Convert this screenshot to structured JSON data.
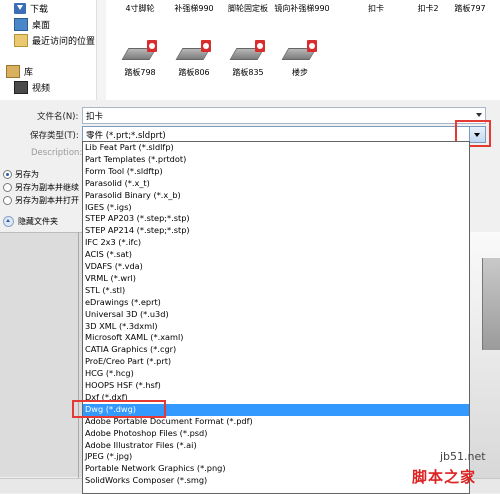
{
  "nav": {
    "items": [
      {
        "label": "下载",
        "icon": "download-folder-icon"
      },
      {
        "label": "桌面",
        "icon": "desktop-icon"
      },
      {
        "label": "最近访问的位置",
        "icon": "recent-places-icon"
      },
      {
        "label": "库",
        "icon": "library-icon"
      },
      {
        "label": "视频",
        "icon": "video-icon"
      }
    ]
  },
  "files": [
    {
      "label": "4寸脚轮"
    },
    {
      "label": "补强梯990"
    },
    {
      "label": "脚轮固定板"
    },
    {
      "label": "镜向补强梯990"
    },
    {
      "label": "扣卡"
    },
    {
      "label": "扣卡2"
    },
    {
      "label": "踏板797"
    },
    {
      "label": "踏板798"
    },
    {
      "label": "踏板806"
    },
    {
      "label": "踏板835"
    },
    {
      "label": "楼步"
    }
  ],
  "form": {
    "filename_label": "文件名(N):",
    "filename_value": "扣卡",
    "savetype_label": "保存类型(T):",
    "savetype_value": "零件 (*.prt;*.sldprt)",
    "description_label": "Description:",
    "options": [
      {
        "label": "另存为",
        "selected": true
      },
      {
        "label": "另存为副本并继续",
        "selected": false
      },
      {
        "label": "另存为副本并打开",
        "selected": false
      }
    ],
    "hide_folders_label": "隐藏文件夹"
  },
  "dropdown": {
    "selected_index": 26,
    "options": [
      "Lib Feat Part (*.sldlfp)",
      "Part Templates (*.prtdot)",
      "Form Tool (*.sldftp)",
      "Parasolid (*.x_t)",
      "Parasolid Binary (*.x_b)",
      "IGES (*.igs)",
      "STEP AP203 (*.step;*.stp)",
      "STEP AP214 (*.step;*.stp)",
      "IFC 2x3 (*.ifc)",
      "ACIS (*.sat)",
      "VDAFS (*.vda)",
      "VRML (*.wrl)",
      "STL (*.stl)",
      "eDrawings (*.eprt)",
      "Universal 3D (*.u3d)",
      "3D XML (*.3dxml)",
      "Microsoft XAML (*.xaml)",
      "CATIA Graphics (*.cgr)",
      "ProE/Creo Part (*.prt)",
      "HCG (*.hcg)",
      "HOOPS HSF (*.hsf)",
      "Dxf (*.dxf)",
      "Dwg (*.dwg)",
      "Adobe Portable Document Format (*.pdf)",
      "Adobe Photoshop Files (*.psd)",
      "Adobe Illustrator Files (*.ai)",
      "JPEG (*.jpg)",
      "Portable Network Graphics (*.png)",
      "SolidWorks Composer (*.smg)"
    ]
  },
  "watermark": {
    "url": "jb51.net",
    "text": "脚本之家"
  },
  "colors": {
    "selection": "#3399ff",
    "annotation_box": "#e53935"
  }
}
